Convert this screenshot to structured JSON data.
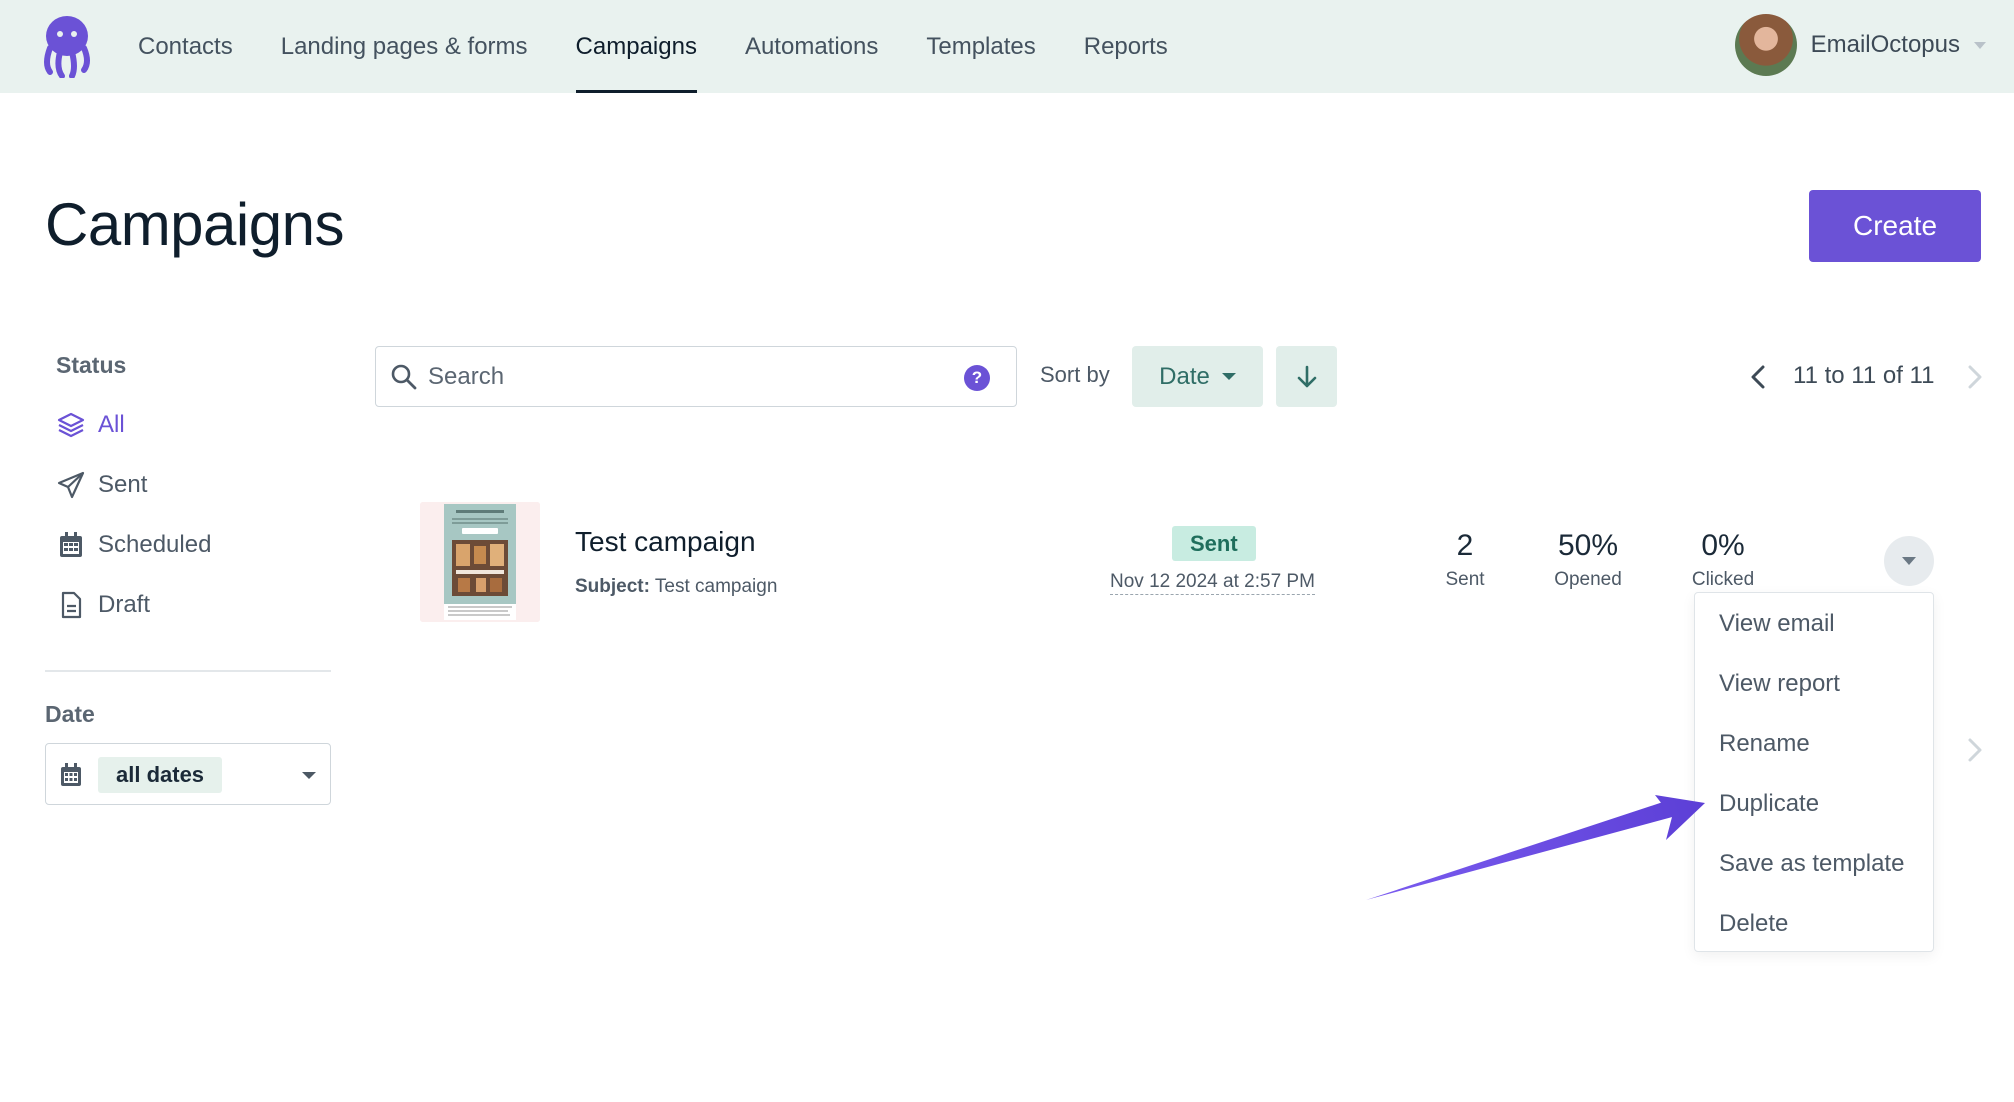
{
  "nav": {
    "logo_icon": "octopus-logo-icon",
    "links": [
      {
        "label": "Contacts"
      },
      {
        "label": "Landing pages & forms"
      },
      {
        "label": "Campaigns",
        "active": true
      },
      {
        "label": "Automations"
      },
      {
        "label": "Templates"
      },
      {
        "label": "Reports"
      }
    ],
    "account_name": "EmailOctopus"
  },
  "page": {
    "title": "Campaigns",
    "create_label": "Create"
  },
  "sidebar": {
    "status_heading": "Status",
    "status_items": [
      {
        "label": "All",
        "icon": "layers-icon",
        "active": true
      },
      {
        "label": "Sent",
        "icon": "paper-plane-icon"
      },
      {
        "label": "Scheduled",
        "icon": "calendar-icon"
      },
      {
        "label": "Draft",
        "icon": "document-icon"
      }
    ],
    "date_heading": "Date",
    "date_value": "all dates"
  },
  "toolbar": {
    "search_placeholder": "Search",
    "sort_label": "Sort by",
    "sort_value": "Date",
    "pagination": "11 to 11 of 11"
  },
  "campaigns": [
    {
      "name": "Test campaign",
      "subject_label": "Subject:",
      "subject": "Test campaign",
      "status": "Sent",
      "date": "Nov 12 2024 at 2:57 PM",
      "stats": [
        {
          "value": "2",
          "label": "Sent"
        },
        {
          "value": "50%",
          "label": "Opened"
        },
        {
          "value": "0%",
          "label": "Clicked"
        }
      ]
    }
  ],
  "row_menu": {
    "items": [
      "View email",
      "View report",
      "Rename",
      "Duplicate",
      "Save as template",
      "Delete"
    ]
  },
  "colors": {
    "accent": "#6b52d6",
    "nav_bg": "#e9f2ef",
    "sent_badge_bg": "#c8ece1",
    "sort_btn_bg": "#e1eeea"
  }
}
